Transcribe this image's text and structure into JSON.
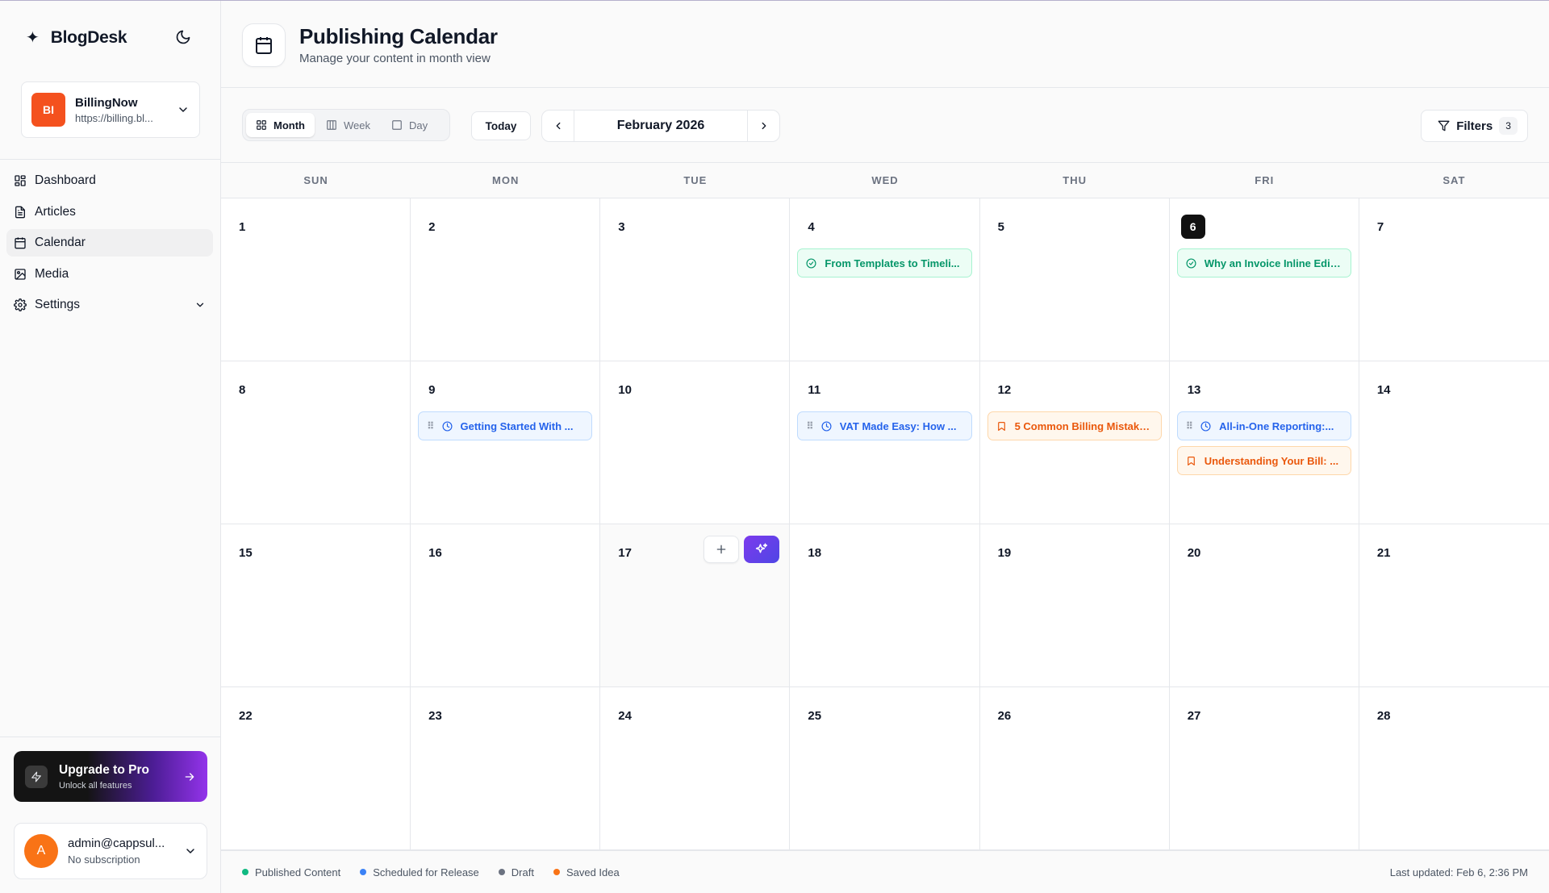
{
  "app": {
    "name": "BlogDesk"
  },
  "workspace": {
    "initials": "BI",
    "name": "BillingNow",
    "url": "https://billing.bl..."
  },
  "nav": {
    "items": [
      {
        "label": "Dashboard",
        "icon": "dashboard-icon"
      },
      {
        "label": "Articles",
        "icon": "document-icon"
      },
      {
        "label": "Calendar",
        "icon": "calendar-icon",
        "active": true
      },
      {
        "label": "Media",
        "icon": "image-icon"
      },
      {
        "label": "Settings",
        "icon": "gear-icon"
      }
    ]
  },
  "upgrade": {
    "title": "Upgrade to Pro",
    "subtitle": "Unlock all features"
  },
  "account": {
    "initial": "A",
    "email": "admin@cappsul...",
    "subscription": "No subscription"
  },
  "header": {
    "title": "Publishing Calendar",
    "subtitle": "Manage your content in month view"
  },
  "toolbar": {
    "views": [
      "Month",
      "Week",
      "Day"
    ],
    "active_view": "Month",
    "today_label": "Today",
    "month_label": "February 2026",
    "filters_label": "Filters",
    "filters_count": "3"
  },
  "calendar": {
    "weekdays": [
      "SUN",
      "MON",
      "TUE",
      "WED",
      "THU",
      "FRI",
      "SAT"
    ],
    "today": "6",
    "hover_day": "17",
    "days": [
      {
        "n": "1",
        "events": []
      },
      {
        "n": "2",
        "events": []
      },
      {
        "n": "3",
        "events": []
      },
      {
        "n": "4",
        "events": [
          {
            "title": "From Templates to Timeli...",
            "status": "published"
          }
        ]
      },
      {
        "n": "5",
        "events": []
      },
      {
        "n": "6",
        "events": [
          {
            "title": "Why an Invoice Inline Edit...",
            "status": "published"
          }
        ]
      },
      {
        "n": "7",
        "events": []
      },
      {
        "n": "8",
        "events": []
      },
      {
        "n": "9",
        "events": [
          {
            "title": "Getting Started With ...",
            "status": "scheduled"
          }
        ]
      },
      {
        "n": "10",
        "events": []
      },
      {
        "n": "11",
        "events": [
          {
            "title": "VAT Made Easy: How ...",
            "status": "scheduled"
          }
        ]
      },
      {
        "n": "12",
        "events": [
          {
            "title": "5 Common Billing Mistake...",
            "status": "idea"
          }
        ]
      },
      {
        "n": "13",
        "events": [
          {
            "title": "All-in-One Reporting:...",
            "status": "scheduled"
          },
          {
            "title": "Understanding Your Bill: ...",
            "status": "idea"
          }
        ]
      },
      {
        "n": "14",
        "events": []
      },
      {
        "n": "15",
        "events": []
      },
      {
        "n": "16",
        "events": []
      },
      {
        "n": "17",
        "events": []
      },
      {
        "n": "18",
        "events": []
      },
      {
        "n": "19",
        "events": []
      },
      {
        "n": "20",
        "events": []
      },
      {
        "n": "21",
        "events": []
      },
      {
        "n": "22",
        "events": []
      },
      {
        "n": "23",
        "events": []
      },
      {
        "n": "24",
        "events": []
      },
      {
        "n": "25",
        "events": []
      },
      {
        "n": "26",
        "events": []
      },
      {
        "n": "27",
        "events": []
      },
      {
        "n": "28",
        "events": []
      }
    ]
  },
  "legend": [
    {
      "label": "Published Content",
      "color": "#10b981"
    },
    {
      "label": "Scheduled for Release",
      "color": "#3b82f6"
    },
    {
      "label": "Draft",
      "color": "#6b7280"
    },
    {
      "label": "Saved Idea",
      "color": "#f97316"
    }
  ],
  "footer": {
    "last_updated": "Last updated: Feb 6, 2:36 PM"
  }
}
